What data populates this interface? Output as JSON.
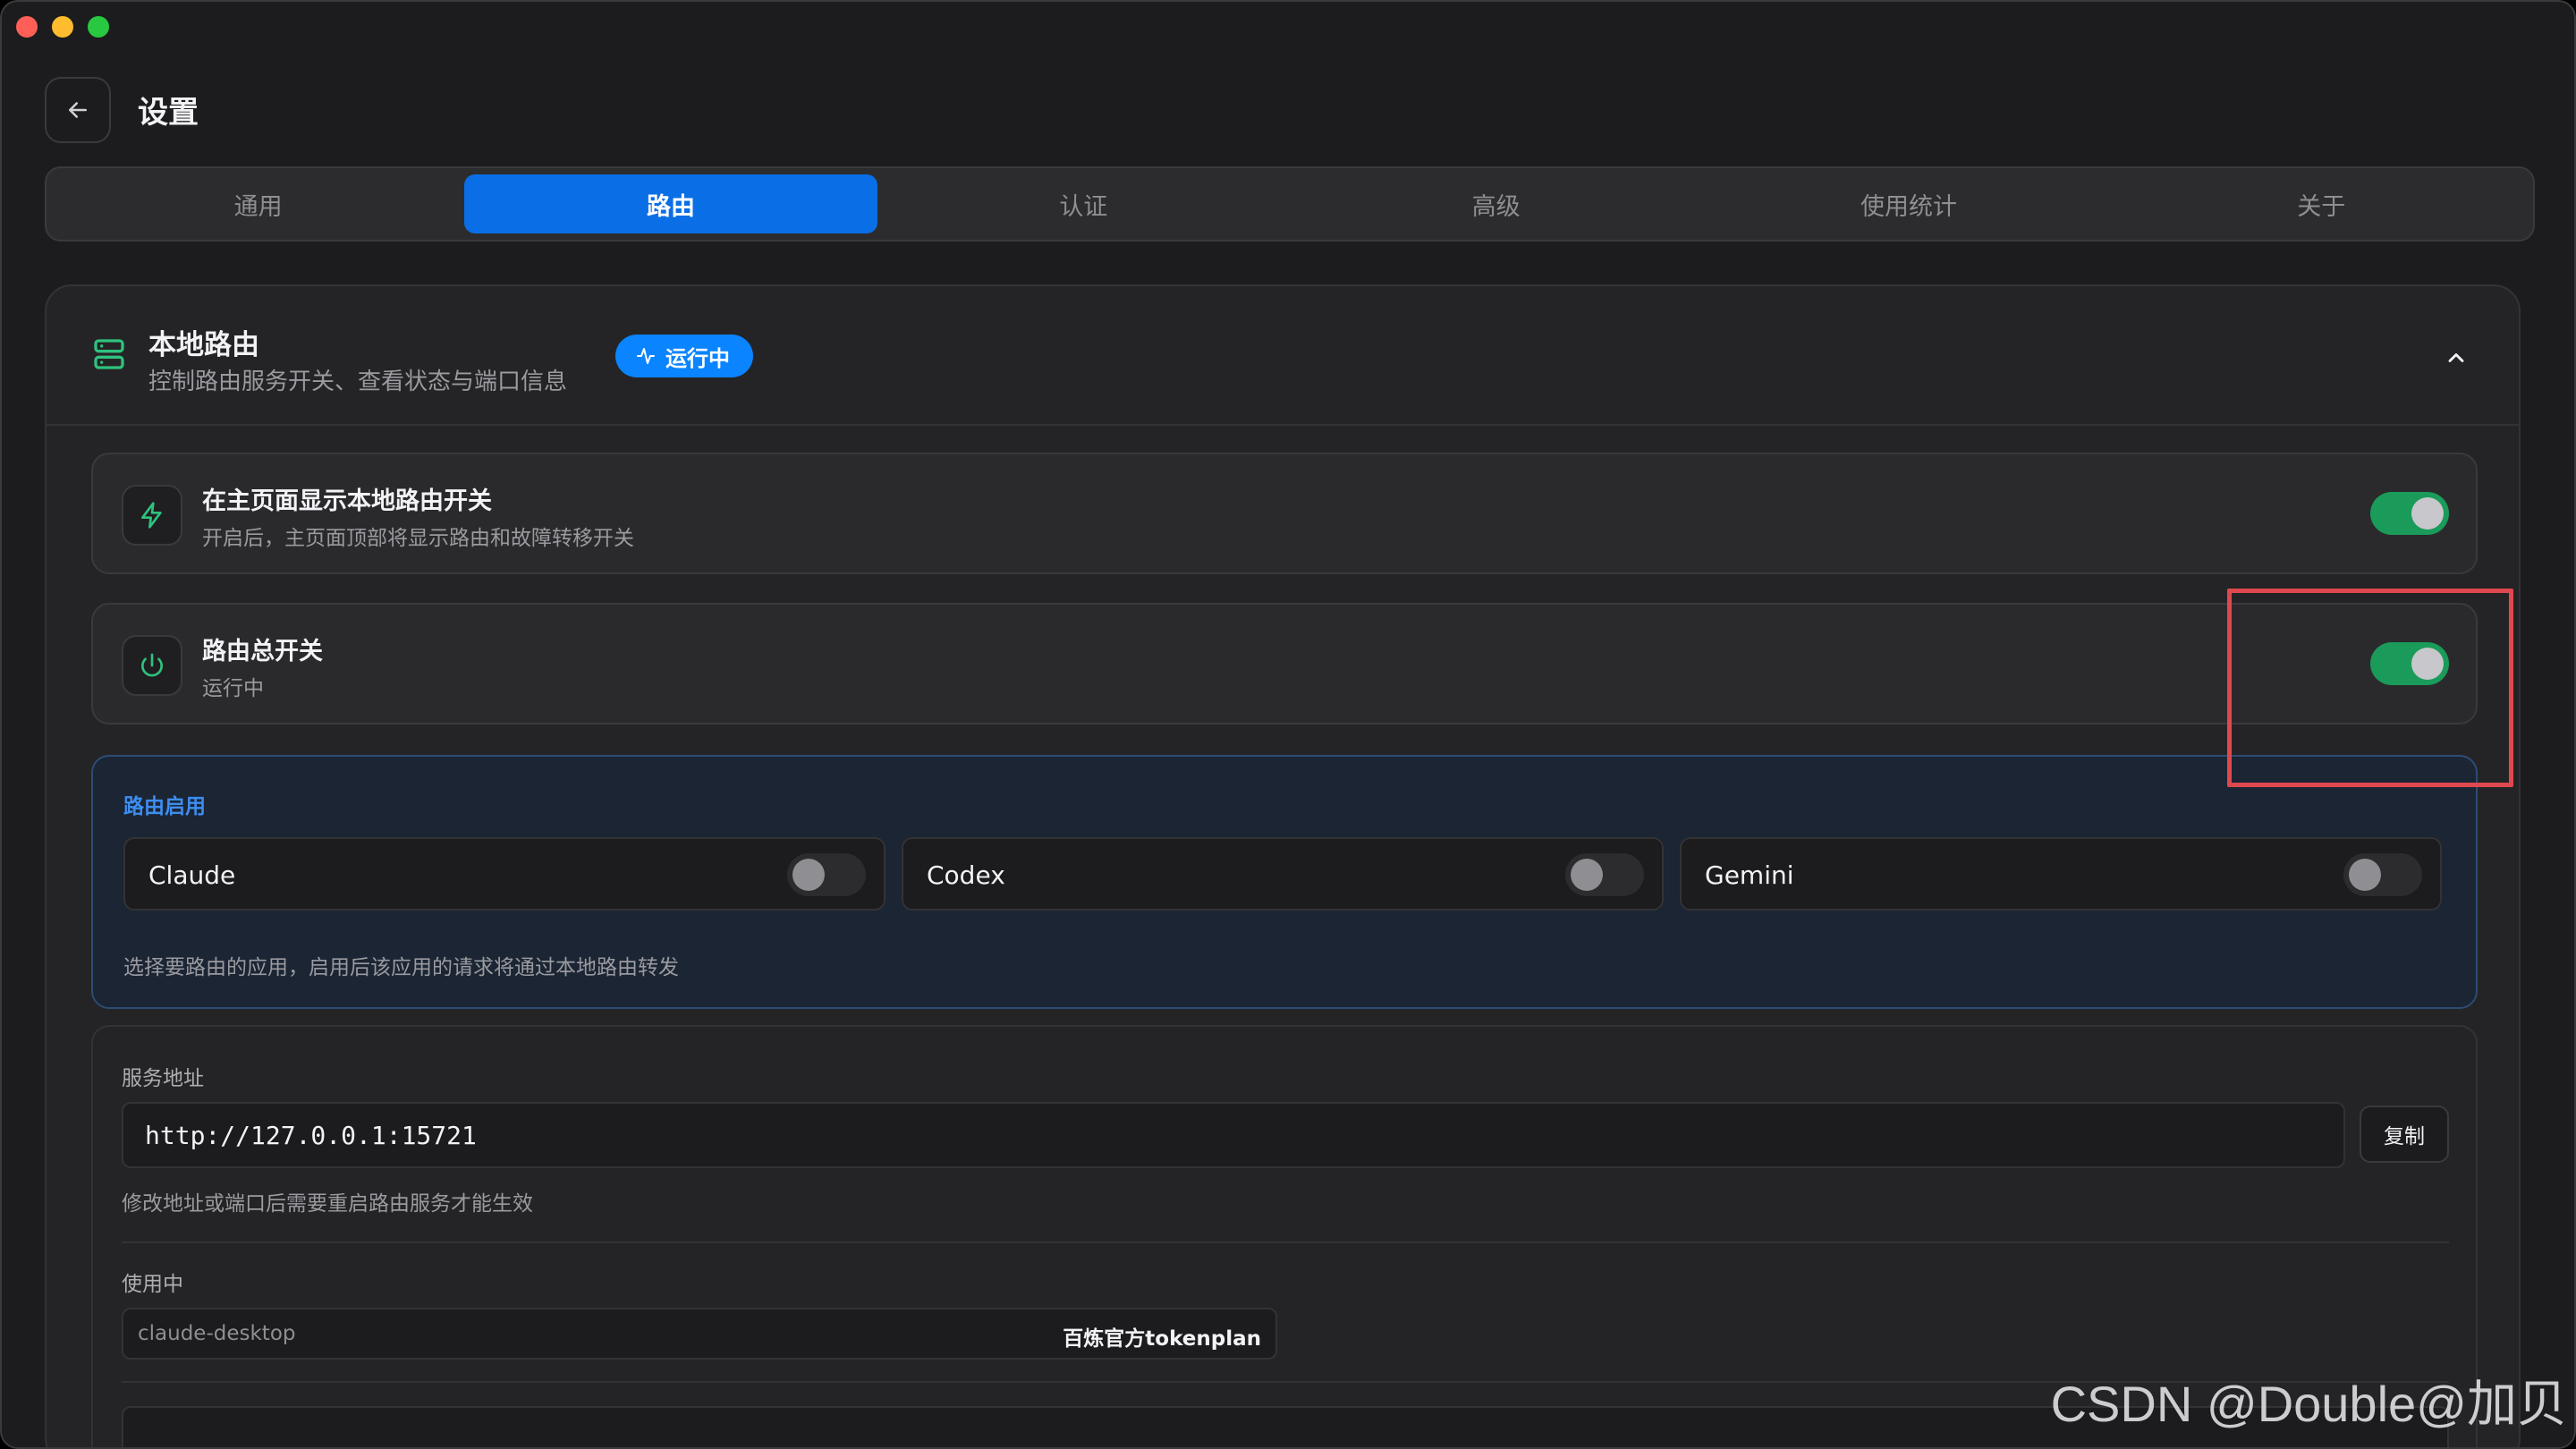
{
  "page": {
    "title": "设置"
  },
  "tabs": [
    {
      "label": "通用",
      "active": false
    },
    {
      "label": "路由",
      "active": true
    },
    {
      "label": "认证",
      "active": false
    },
    {
      "label": "高级",
      "active": false
    },
    {
      "label": "使用统计",
      "active": false
    },
    {
      "label": "关于",
      "active": false
    }
  ],
  "section": {
    "title": "本地路由",
    "subtitle": "控制路由服务开关、查看状态与端口信息",
    "badge": "运行中"
  },
  "show_toggle": {
    "title": "在主页面显示本地路由开关",
    "subtitle": "开启后，主页面顶部将显示路由和故障转移开关",
    "enabled": true
  },
  "master_toggle": {
    "title": "路由总开关",
    "subtitle": "运行中",
    "enabled": true
  },
  "routing_apps": {
    "label": "路由启用",
    "apps": [
      {
        "name": "Claude",
        "enabled": false
      },
      {
        "name": "Codex",
        "enabled": false
      },
      {
        "name": "Gemini",
        "enabled": false
      }
    ],
    "hint": "选择要路由的应用，启用后该应用的请求将通过本地路由转发"
  },
  "service": {
    "label": "服务地址",
    "url": "http://127.0.0.1:15721",
    "copy_label": "复制",
    "hint": "修改地址或端口后需要重启路由服务才能生效"
  },
  "in_use": {
    "label": "使用中",
    "client": "claude-desktop",
    "provider": "百炼官方tokenplan"
  },
  "watermark": "CSDN @Double@加贝",
  "colors": {
    "accent": "#0a6ee6",
    "toggle_on": "#1a9b5a",
    "highlight": "#e0484f"
  }
}
